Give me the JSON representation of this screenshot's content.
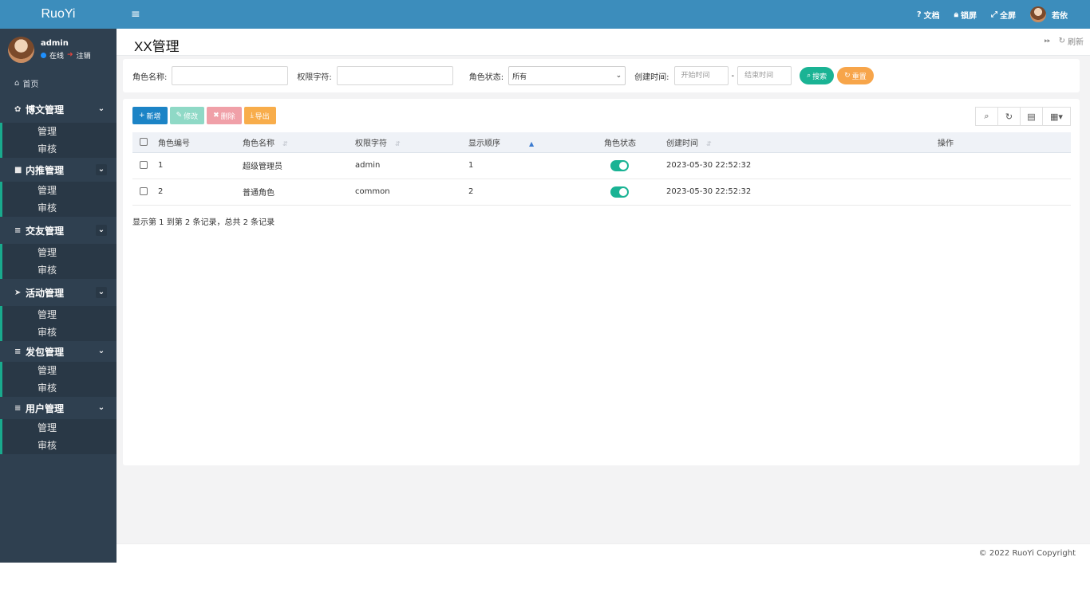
{
  "brand": "RuoYi",
  "user": {
    "name": "admin",
    "status": "在线",
    "logout": "注销"
  },
  "sidebar": {
    "home": "首页",
    "groups": [
      {
        "title": "博文管理",
        "icon": "gear-icon",
        "items": [
          "管理",
          "审核"
        ]
      },
      {
        "title": "内推管理",
        "icon": "video-icon",
        "items": [
          "管理",
          "审核"
        ]
      },
      {
        "title": "交友管理",
        "icon": "list-icon",
        "items": [
          "管理",
          "审核"
        ]
      },
      {
        "title": "活动管理",
        "icon": "send-icon",
        "items": [
          "管理",
          "审核"
        ]
      },
      {
        "title": "发包管理",
        "icon": "list-icon",
        "items": [
          "管理",
          "审核"
        ]
      },
      {
        "title": "用户管理",
        "icon": "list-icon",
        "items": [
          "管理",
          "审核"
        ]
      }
    ]
  },
  "topnav": {
    "docs": "文档",
    "lock": "锁屏",
    "fullscreen": "全屏",
    "username": "若依"
  },
  "page": {
    "title": "XX管理",
    "refresh": "刷新"
  },
  "search": {
    "role_name_label": "角色名称:",
    "perm_label": "权限字符:",
    "status_label": "角色状态:",
    "status_value": "所有",
    "created_label": "创建时间:",
    "start_placeholder": "开始时间",
    "end_placeholder": "结束时间",
    "range_sep": "-",
    "search_btn": "搜索",
    "reset_btn": "重置"
  },
  "toolbar": {
    "add": "新增",
    "edit": "修改",
    "delete": "删除",
    "export": "导出"
  },
  "table": {
    "columns": [
      "角色编号",
      "角色名称",
      "权限字符",
      "显示顺序",
      "角色状态",
      "创建时间",
      "操作"
    ],
    "rows": [
      {
        "id": "1",
        "name": "超级管理员",
        "key": "admin",
        "order": "1",
        "enabled": true,
        "created": "2023-05-30 22:52:32"
      },
      {
        "id": "2",
        "name": "普通角色",
        "key": "common",
        "order": "2",
        "enabled": true,
        "created": "2023-05-30 22:52:32"
      }
    ],
    "summary": "显示第 1 到第 2 条记录，总共 2 条记录"
  },
  "footer": "© 2022 RuoYi Copyright",
  "colors": {
    "brand_blue": "#3c8dbc",
    "sidebar_bg": "#2f4050",
    "primary_green": "#1ab394",
    "add_blue": "#1c84c6",
    "warning": "#f8ad4b"
  }
}
